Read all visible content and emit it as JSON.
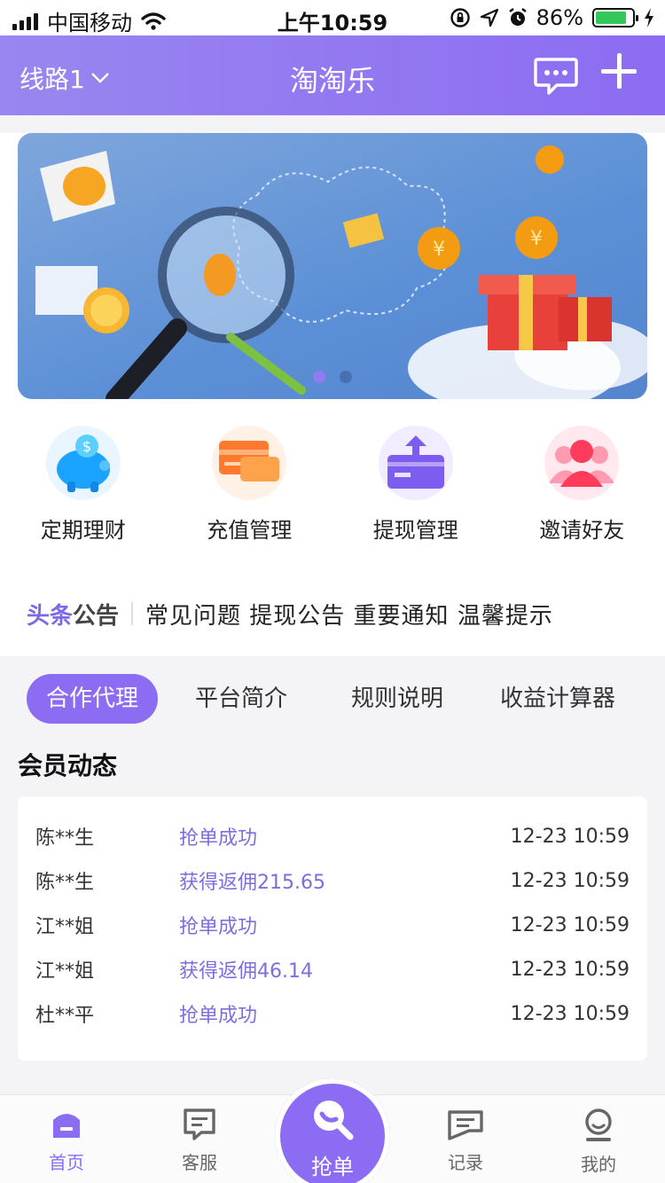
{
  "status_bar": {
    "carrier": "中国移动",
    "time": "上午10:59",
    "battery_pct": "86%",
    "battery_level": 0.86
  },
  "header": {
    "route_label": "线路1",
    "title": "淘淘乐"
  },
  "banner": {
    "slide_count": 2,
    "active_index": 0
  },
  "menu": [
    {
      "label": "定期理财",
      "icon": "piggy-bank-icon"
    },
    {
      "label": "充值管理",
      "icon": "card-icon"
    },
    {
      "label": "提现管理",
      "icon": "withdraw-icon"
    },
    {
      "label": "邀请好友",
      "icon": "friends-icon"
    }
  ],
  "notice": {
    "tag_a": "头条",
    "tag_b": "公告",
    "items": "常见问题 提现公告 重要通知 温馨提示"
  },
  "tabs": [
    "合作代理",
    "平台简介",
    "规则说明",
    "收益计算器"
  ],
  "member_feed": {
    "title": "会员动态",
    "rows": [
      {
        "name": "陈**生",
        "action": "抢单成功",
        "time": "12-23 10:59"
      },
      {
        "name": "陈**生",
        "action": "获得返佣215.65",
        "time": "12-23 10:59"
      },
      {
        "name": "江**姐",
        "action": "抢单成功",
        "time": "12-23 10:59"
      },
      {
        "name": "江**姐",
        "action": "获得返佣46.14",
        "time": "12-23 10:59"
      },
      {
        "name": "杜**平",
        "action": "抢单成功",
        "time": "12-23 10:59"
      }
    ]
  },
  "tabbar": {
    "home": "首页",
    "service": "客服",
    "grab": "抢单",
    "records": "记录",
    "mine": "我的"
  },
  "colors": {
    "accent": "#8c6cf2",
    "link": "#7f6de0"
  }
}
